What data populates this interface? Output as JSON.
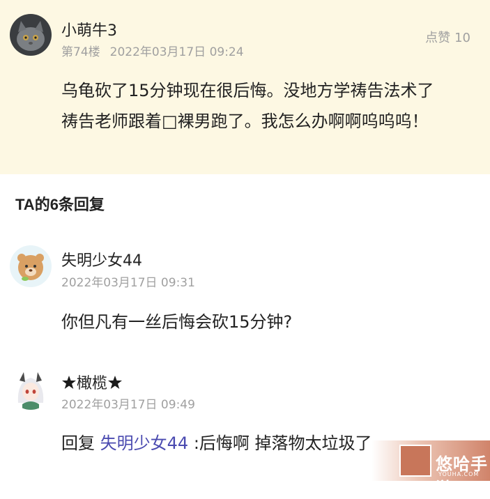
{
  "post": {
    "username": "小萌牛3",
    "floor": "第74楼",
    "datetime": "2022年03月17日 09:24",
    "likes_label": "点赞",
    "likes_count": "10",
    "content_line1": "乌龟砍了15分钟现在很后悔。没地方学祷告法术了",
    "content_line2": "祷告老师跟着□裸男跑了。我怎么办啊啊呜呜呜！",
    "avatar_icon": "gray-cat-avatar-icon"
  },
  "replies_section": {
    "title": "TA的6条回复"
  },
  "replies": [
    {
      "username": "失明少女44",
      "datetime": "2022年03月17日 09:31",
      "content": "你但凡有一丝后悔会砍15分钟?",
      "avatar_icon": "cartoon-bear-avatar-icon"
    },
    {
      "username": "橄榄",
      "datetime": "2022年03月17日 09:49",
      "reply_prefix": "回复",
      "reply_to": "失明少女44",
      "content": ":后悔啊 掉落物太垃圾了",
      "avatar_icon": "anime-girl-avatar-icon"
    }
  ],
  "watermark": {
    "brand": "悠哈手游",
    "url": "YOUHA.COM"
  },
  "colors": {
    "post_background": "#fdf8e3",
    "reply_link": "#4a4ab0",
    "meta_text": "#a0a0a0"
  }
}
